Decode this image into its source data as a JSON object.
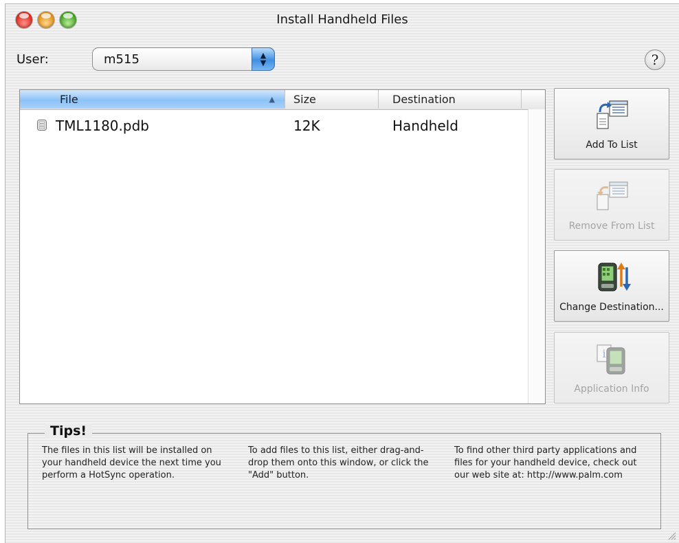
{
  "window": {
    "title": "Install Handheld Files",
    "controls": [
      "close-button",
      "minimize-button",
      "zoom-button"
    ]
  },
  "user_selector": {
    "label": "User:",
    "selected": "m515"
  },
  "help_button": {
    "label": "?"
  },
  "file_list": {
    "columns": [
      "File",
      "Size",
      "Destination"
    ],
    "sorted_column": "File",
    "sort_direction": "ascending",
    "rows": [
      {
        "file": "TML1180.pdb",
        "size": "12K",
        "destination": "Handheld"
      }
    ]
  },
  "buttons": {
    "add_to_list": {
      "label": "Add To List",
      "enabled": true,
      "icon": "add-to-list-icon"
    },
    "remove_from_list": {
      "label": "Remove From List",
      "enabled": false,
      "icon": "remove-from-list-icon"
    },
    "change_destination": {
      "label": "Change Destination...",
      "enabled": true,
      "icon": "change-destination-icon"
    },
    "application_info": {
      "label": "Application Info",
      "enabled": false,
      "icon": "application-info-icon"
    }
  },
  "tips": {
    "title": "Tips!",
    "items": [
      "The files in this list will be installed on your handheld device the next time you perform a HotSync operation.",
      "To add files to this list, either drag-and-drop them onto this window, or click the \"Add\" button.",
      "To find other third party applications and files for your handheld device, check out our web site at: http://www.palm.com"
    ]
  },
  "colors": {
    "header_selected": "#8dc2f7",
    "popup_arrows": "#3f8fe4",
    "close": "#d8261a",
    "minimize": "#de8a10",
    "zoom": "#3e9b1d"
  }
}
